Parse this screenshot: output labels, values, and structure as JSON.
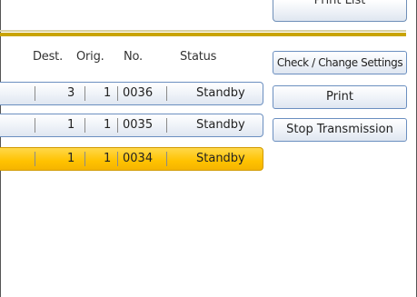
{
  "top_button": {
    "label": "Print List"
  },
  "columns": {
    "dest": "Dest.",
    "orig": "Orig.",
    "no": "No.",
    "status": "Status"
  },
  "rows": [
    {
      "dest": "3",
      "orig": "1",
      "no": "0036",
      "status": "Standby",
      "selected": false
    },
    {
      "dest": "1",
      "orig": "1",
      "no": "0035",
      "status": "Standby",
      "selected": false
    },
    {
      "dest": "1",
      "orig": "1",
      "no": "0034",
      "status": "Standby",
      "selected": true
    }
  ],
  "actions": {
    "check_change": "Check / Change Settings",
    "print": "Print",
    "stop": "Stop Transmission"
  },
  "colors": {
    "accent_gold": "#c9a400",
    "selected_row": "#ffc200",
    "button_border": "#6b8fc0"
  }
}
